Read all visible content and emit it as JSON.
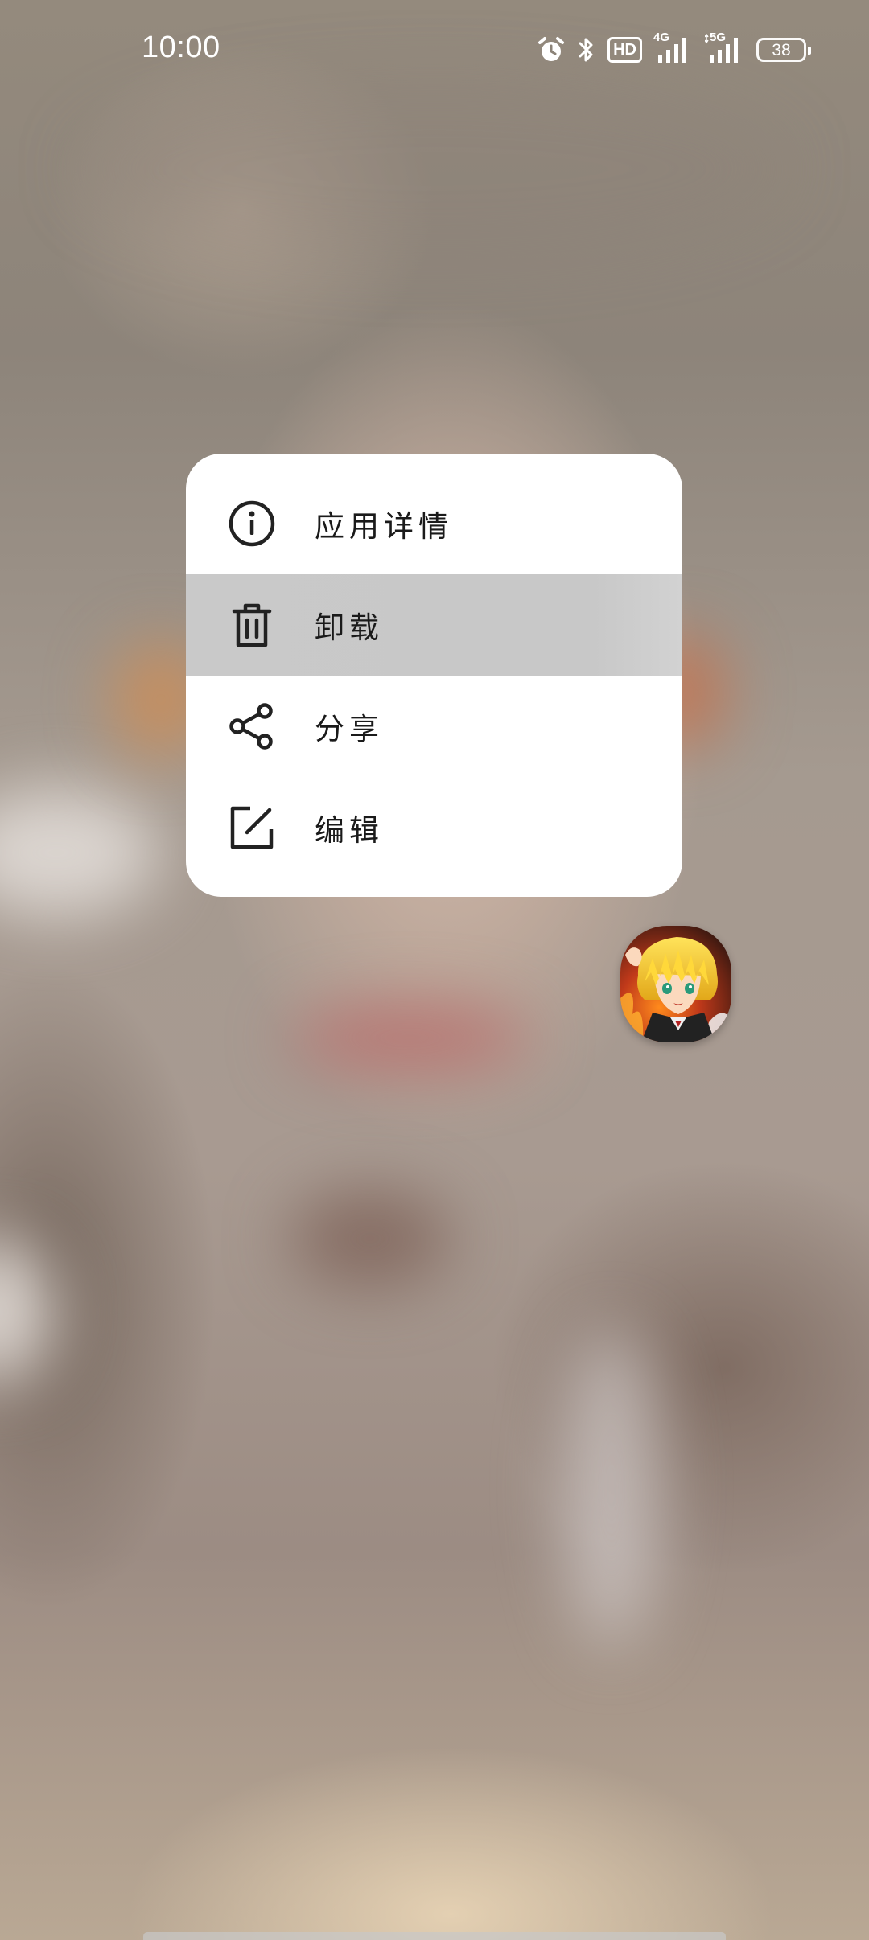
{
  "status_bar": {
    "time": "10:00",
    "hd_label": "HD",
    "network_4g": "4G",
    "network_5g": "5G",
    "battery_level": "38",
    "icons": [
      "alarm-icon",
      "bluetooth-icon",
      "hd-voice-icon",
      "signal-4g-icon",
      "signal-5g-icon",
      "battery-icon"
    ]
  },
  "context_menu": {
    "items": [
      {
        "label": "应用详情",
        "icon": "info-icon",
        "highlighted": false
      },
      {
        "label": "卸载",
        "icon": "trash-icon",
        "highlighted": true
      },
      {
        "label": "分享",
        "icon": "share-icon",
        "highlighted": false
      },
      {
        "label": "编辑",
        "icon": "edit-icon",
        "highlighted": false
      }
    ]
  },
  "app_icon": {
    "icon": "anime-character-app-icon"
  },
  "colors": {
    "menu_background": "#ffffff",
    "menu_highlight": "#c8c8c8",
    "menu_text": "#1a1a1a",
    "status_text": "#ffffff"
  }
}
